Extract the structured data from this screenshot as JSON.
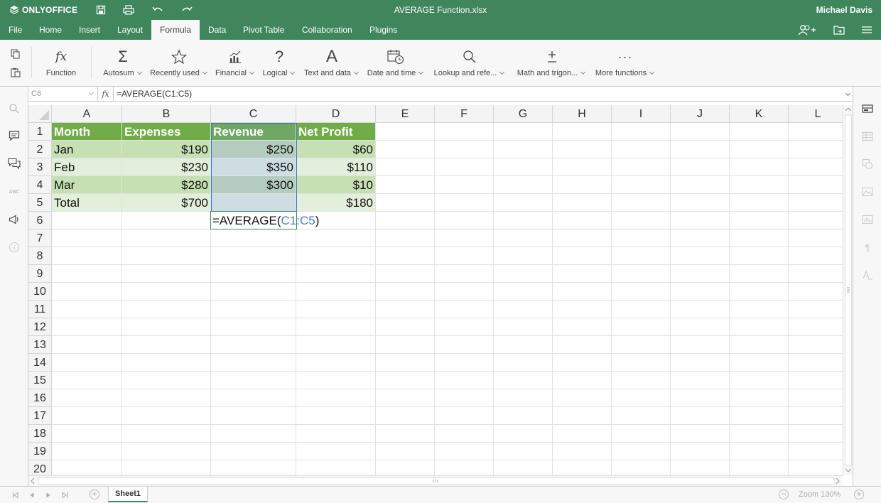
{
  "app": {
    "logo_text": "ONLYOFFICE",
    "title": "AVERAGE Function.xlsx",
    "user": "Michael Davis"
  },
  "menu": {
    "tabs": [
      "File",
      "Home",
      "Insert",
      "Layout",
      "Formula",
      "Data",
      "Pivot Table",
      "Collaboration",
      "Plugins"
    ],
    "active": "Formula"
  },
  "ribbon": {
    "function": "Function",
    "autosum": "Autosum",
    "recently_used": "Recently used",
    "financial": "Financial",
    "logical": "Logical",
    "text_and_data": "Text and data",
    "date_and_time": "Date and time",
    "lookup": "Lookup and refe...",
    "math": "Math and trigon...",
    "more": "More functions"
  },
  "formula_bar": {
    "name_box": "C6",
    "fx": "fx",
    "formula": "=AVERAGE(C1:C5)"
  },
  "grid": {
    "columns": [
      "A",
      "B",
      "C",
      "D",
      "E",
      "F",
      "G",
      "H",
      "I",
      "J",
      "K",
      "L"
    ],
    "rows": [
      "1",
      "2",
      "3",
      "4",
      "5",
      "6",
      "7",
      "8",
      "9",
      "10",
      "11",
      "12",
      "13",
      "14",
      "15",
      "16",
      "17",
      "18",
      "19",
      "20"
    ],
    "table": {
      "header": [
        "Month",
        "Expenses",
        "Revenue",
        "Net Profit"
      ],
      "rows": [
        [
          "Jan",
          "$190",
          "$250",
          "$60"
        ],
        [
          "Feb",
          "$230",
          "$350",
          "$110"
        ],
        [
          "Mar",
          "$280",
          "$300",
          "$10"
        ],
        [
          "Total",
          "$700",
          "",
          "$180"
        ]
      ]
    },
    "editing": {
      "prefix": "=AVERAGE(",
      "ref": "C1:C5",
      "suffix": ")"
    }
  },
  "colors": {
    "brand_green": "#40865c",
    "table_header": "#70ad47",
    "band_dark": "#c6e0b4",
    "band_light": "#e2efda",
    "selection_border": "#3b75c4"
  },
  "status": {
    "sheet": "Sheet1",
    "zoom": "Zoom 130%"
  }
}
